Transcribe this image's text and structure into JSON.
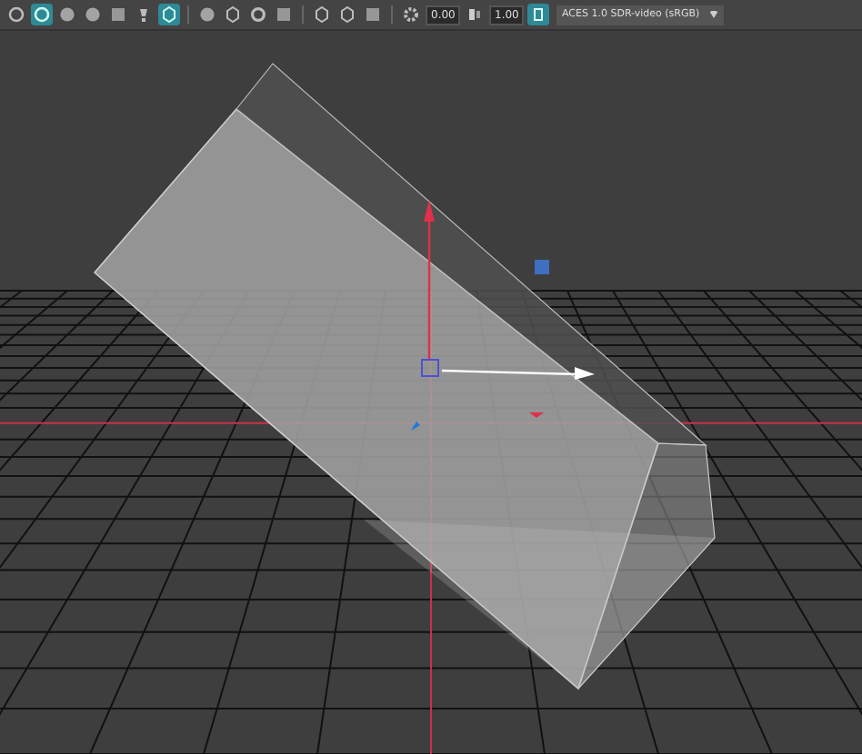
{
  "toolbar": {
    "buttons": [
      {
        "on": false
      },
      {
        "on": true
      },
      {
        "on": false
      },
      {
        "on": false
      },
      {
        "on": false
      },
      {
        "on": false
      },
      {
        "on": true
      },
      {
        "on": false
      },
      {
        "on": false
      },
      {
        "on": false
      },
      {
        "on": false
      },
      {
        "on": false
      },
      {
        "on": false
      },
      {
        "on": false
      },
      {
        "on": false
      }
    ],
    "exposure": "0.00",
    "gamma": "1.00",
    "color_management_on": true,
    "color_space": "ACES 1.0 SDR-video (sRGB)"
  }
}
